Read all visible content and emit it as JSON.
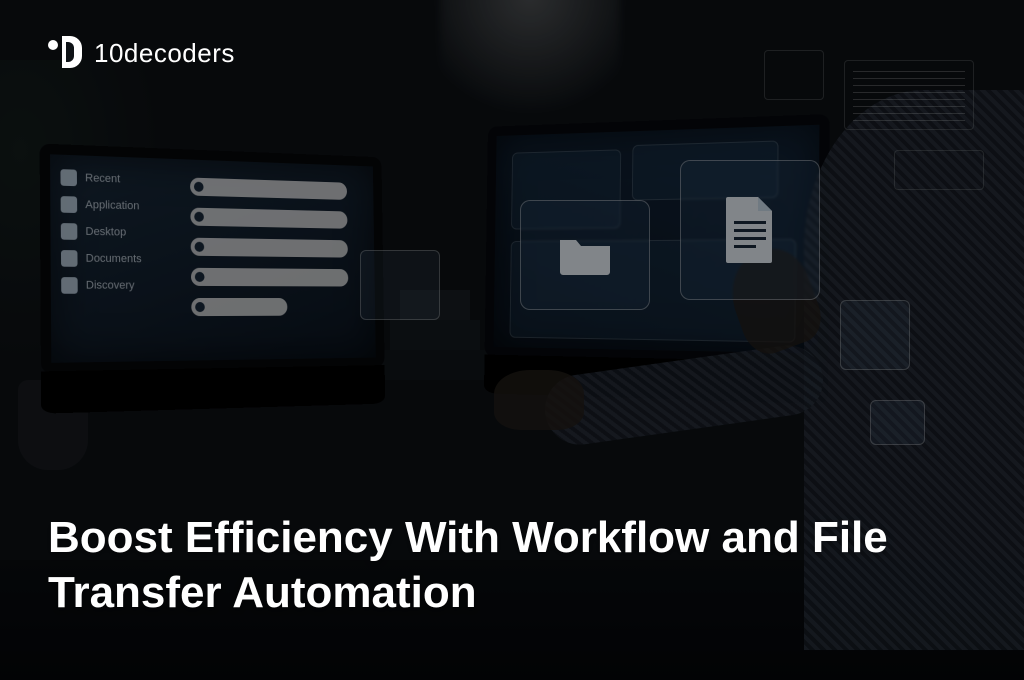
{
  "brand": {
    "name": "10decoders"
  },
  "headline": "Boost Efficiency With Workflow and File Transfer Automation",
  "laptop_left_sidebar": [
    "Recent",
    "Application",
    "Desktop",
    "Documents",
    "Discovery"
  ],
  "icons": {
    "folder": "folder-icon",
    "document": "document-icon"
  }
}
